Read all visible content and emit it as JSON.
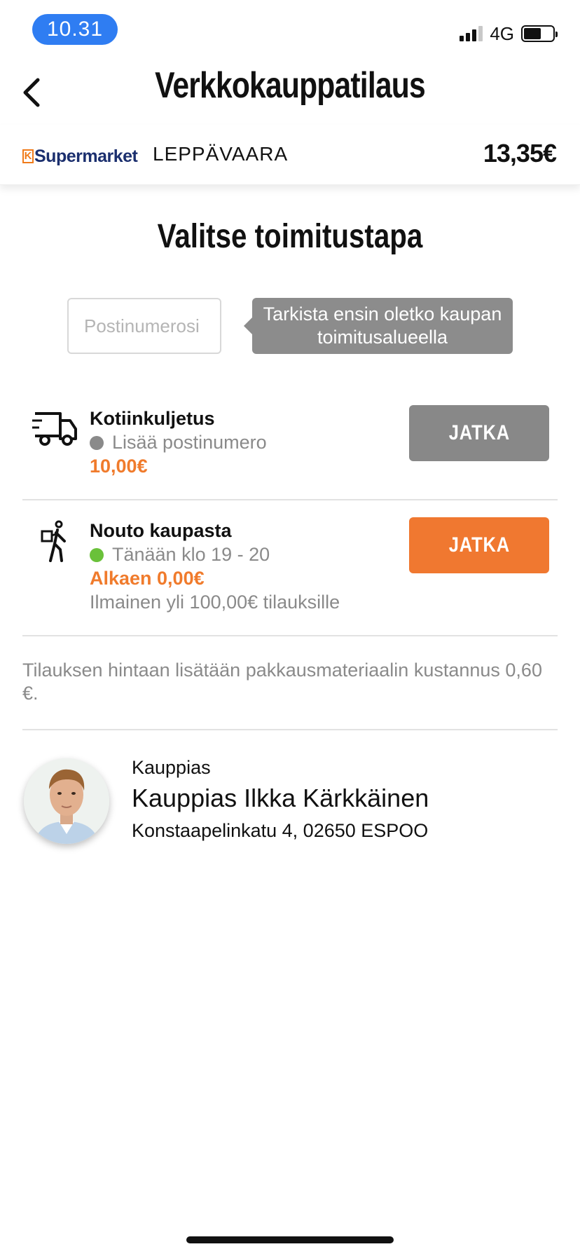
{
  "status_bar": {
    "time": "10.31",
    "network": "4G",
    "battery_level": 0.6
  },
  "header": {
    "title": "Verkkokauppatilaus",
    "back_icon": "chevron-left-icon"
  },
  "store": {
    "logo_mark": "K",
    "logo_text": "Supermarket",
    "name": "LEPPÄVAARA",
    "cart_total": "13,35€"
  },
  "delivery": {
    "heading": "Valitse toimitustapa",
    "postcode_placeholder": "Postinumerosi",
    "postcode_value": "",
    "tooltip": "Tarkista ensin oletko kaupan toimitusalueella",
    "options": [
      {
        "icon": "delivery-truck-icon",
        "title": "Kotiinkuljetus",
        "status": "Lisää postinumero",
        "status_color": "#8a8a8a",
        "price": "10,00€",
        "button_label": "JATKA",
        "button_color": "#888888"
      },
      {
        "icon": "pickup-person-icon",
        "title": "Nouto kaupasta",
        "status": "Tänään klo 19 - 20",
        "status_color": "#6ac13a",
        "price": "Alkaen 0,00€",
        "note": "Ilmainen yli 100,00€ tilauksille",
        "button_label": "JATKA",
        "button_color": "#f07830"
      }
    ],
    "packaging_note": "Tilauksen hintaan lisätään pakkausmateriaalin kustannus 0,60 €."
  },
  "merchant": {
    "label": "Kauppias",
    "name": "Kauppias Ilkka Kärkkäinen",
    "address": "Konstaapelinkatu 4, 02650 ESPOO"
  },
  "colors": {
    "accent": "#f07830",
    "status_pill": "#2f7df2",
    "brand_blue": "#1b2f6e"
  }
}
